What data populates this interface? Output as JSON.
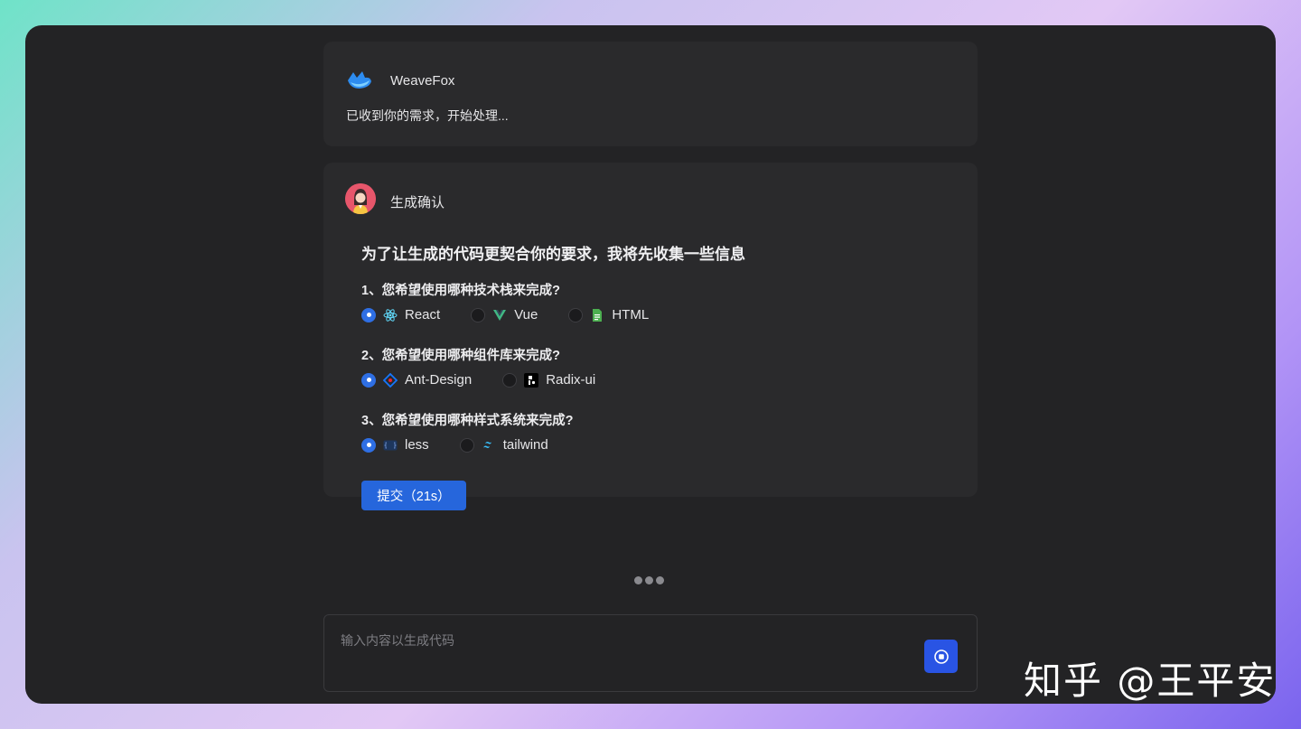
{
  "chat": {
    "bot_message": {
      "sender": "WeaveFox",
      "text": "已收到你的需求，开始处理..."
    },
    "confirm": {
      "sender": "生成确认",
      "title": "为了让生成的代码更契合你的要求，我将先收集一些信息",
      "questions": [
        {
          "label": "1、您希望使用哪种技术栈来完成?",
          "options": [
            {
              "label": "React",
              "icon": "react-icon",
              "selected": true
            },
            {
              "label": "Vue",
              "icon": "vue-icon",
              "selected": false
            },
            {
              "label": "HTML",
              "icon": "html-icon",
              "selected": false
            }
          ]
        },
        {
          "label": "2、您希望使用哪种组件库来完成?",
          "options": [
            {
              "label": "Ant-Design",
              "icon": "ant-design-icon",
              "selected": true
            },
            {
              "label": "Radix-ui",
              "icon": "radix-icon",
              "selected": false
            }
          ]
        },
        {
          "label": "3、您希望使用哪种样式系统来完成?",
          "options": [
            {
              "label": "less",
              "icon": "less-icon",
              "selected": true
            },
            {
              "label": "tailwind",
              "icon": "tailwind-icon",
              "selected": false
            }
          ]
        }
      ],
      "submit_label": "提交（21s）"
    }
  },
  "input": {
    "placeholder": "输入内容以生成代码"
  },
  "watermark": "知乎 @王平安",
  "colors": {
    "accent": "#2f6fe4",
    "window_bg": "#232325",
    "card_bg": "#2a2a2c"
  }
}
